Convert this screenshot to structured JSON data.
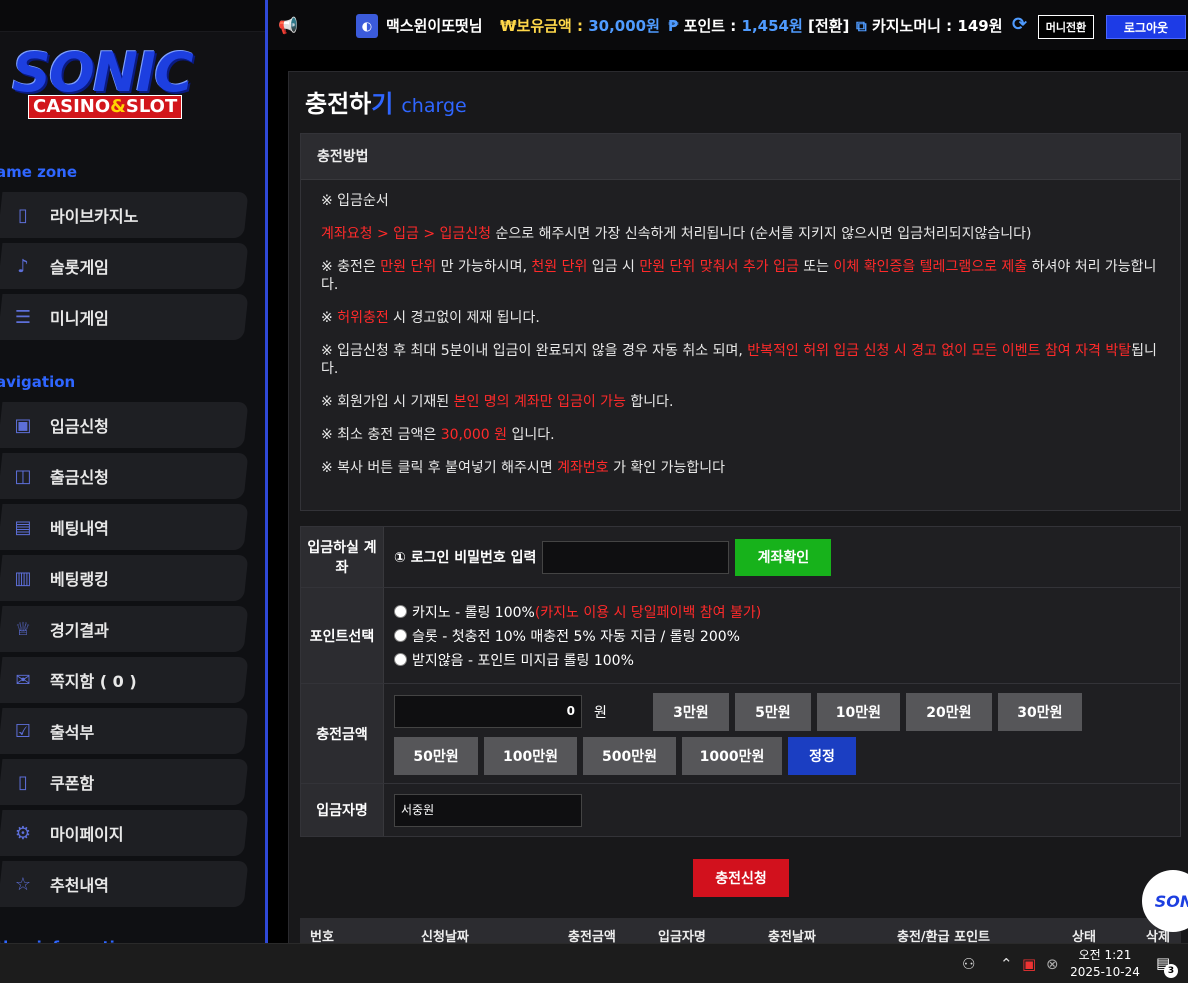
{
  "sidebar": {
    "logo_main": "SONIC",
    "logo_sub_left": "CASINO",
    "logo_sub_amp": "&",
    "logo_sub_right": "SLOT",
    "section_game": "ame zone",
    "section_nav": "avigation",
    "section_info": "ther information",
    "game_items": [
      {
        "label": "라이브카지노",
        "icon": "phone-icon"
      },
      {
        "label": "슬롯게임",
        "icon": "slot-icon"
      },
      {
        "label": "미니게임",
        "icon": "list-icon"
      }
    ],
    "nav_items": [
      {
        "label": "입금신청",
        "icon": "deposit-icon"
      },
      {
        "label": "출금신청",
        "icon": "wallet-icon"
      },
      {
        "label": "베팅내역",
        "icon": "bet-history-icon"
      },
      {
        "label": "베팅랭킹",
        "icon": "ranking-icon"
      },
      {
        "label": "경기결과",
        "icon": "trophy-icon"
      },
      {
        "label": "쪽지함 ( 0 )",
        "icon": "message-icon"
      },
      {
        "label": "출석부",
        "icon": "calendar-icon"
      },
      {
        "label": "쿠폰함",
        "icon": "coupon-icon"
      },
      {
        "label": "마이페이지",
        "icon": "gear-icon"
      },
      {
        "label": "추천내역",
        "icon": "user-star-icon"
      }
    ]
  },
  "header": {
    "username": "맥스윈이또떳님",
    "hold_prefix": "₩",
    "hold_label": "보유금액 : ",
    "hold_value": "30,000원",
    "points_prefix": "₱",
    "points_label": " 포인트 : ",
    "points_value": "1,454원",
    "points_action": " [전환]",
    "casino_label": " 카지노머니 : 149원",
    "mini_btn": "머니전환",
    "logout_btn": "로그아웃"
  },
  "page": {
    "title_main": "충전하",
    "title_accent": "기",
    "title_en": "charge"
  },
  "guide": {
    "heading": "충전방법",
    "p1": "※ 입금순서",
    "p2_red": "계좌요청 > 입금 > 입금신청",
    "p2_rest": " 순으로 해주시면 가장 신속하게 처리됩니다 (순서를 지키지 않으시면 입금처리되지않습니다)",
    "p3_a": "※ 충전은 ",
    "p3_b": "만원 단위",
    "p3_c": " 만 가능하시며, ",
    "p3_d": "천원 단위",
    "p3_e": " 입금 시 ",
    "p3_f": "만원 단위 맞춰서 추가 입금",
    "p3_g": " 또는 ",
    "p3_h": "이체 확인증을 텔레그램으로 제출",
    "p3_i": " 하셔야 처리 가능합니다.",
    "p4_a": "※ ",
    "p4_b": "허위충전",
    "p4_c": " 시 경고없이 제재 됩니다.",
    "p5_a": "※ 입금신청 후 최대 5분이내 입금이 완료되지 않을 경우 자동 취소 되며, ",
    "p5_b": "반복적인 허위 입금 신청 시 경고 없이 모든 이벤트 참여 자격 박탈",
    "p5_c": "됩니다.",
    "p6_a": "※ 회원가입 시 기재된 ",
    "p6_b": "본인 명의 계좌만 입금이 가능",
    "p6_c": " 합니다.",
    "p7_a": "※ 최소 충전 금액은 ",
    "p7_b": "30,000 원",
    "p7_c": " 입니다.",
    "p8_a": "※ 복사 버튼 클릭 후 붙여넣기 해주시면 ",
    "p8_b": "계좌번호",
    "p8_c": " 가 확인 가능합니다"
  },
  "form": {
    "account_label": "입금하실 계좌",
    "pw_label": "① 로그인 비밀번호 입력",
    "pw_value": "",
    "account_btn": "계좌확인",
    "point_label": "포인트선택",
    "point_opt1_a": "카지노 - 롤링 100% ",
    "point_opt1_b": "(카지노 이용 시 당일페이백 참여 불가)",
    "point_opt2": "슬롯 - 첫충전 10% 매충전 5% 자동 지급 / 롤링 200%",
    "point_opt3": "받지않음 - 포인트 미지급 롤링 100%",
    "amount_label": "충전금액",
    "amount_value": "0",
    "amount_unit": "원",
    "amount_buttons": [
      "3만원",
      "5만원",
      "10만원",
      "20만원",
      "30만원",
      "50만원",
      "100만원",
      "500만원",
      "1000만원",
      "정정"
    ],
    "name_label": "입금자명",
    "name_value": "서중원",
    "submit": "충전신청"
  },
  "table": {
    "headers": [
      "번호",
      "신청날짜",
      "충전금액",
      "입금자명",
      "충전날짜",
      "충전/환급 포인트",
      "상태",
      "삭제"
    ]
  },
  "float_logo": "SONI",
  "taskbar": {
    "time": "오전 1:21",
    "date": "2025-10-24",
    "notif_count": "3"
  },
  "colors": {
    "accent_blue": "#2f66ff",
    "warning_red": "#ff2a2a",
    "confirm_green": "#17b21b",
    "submit_red": "#d2111d"
  }
}
